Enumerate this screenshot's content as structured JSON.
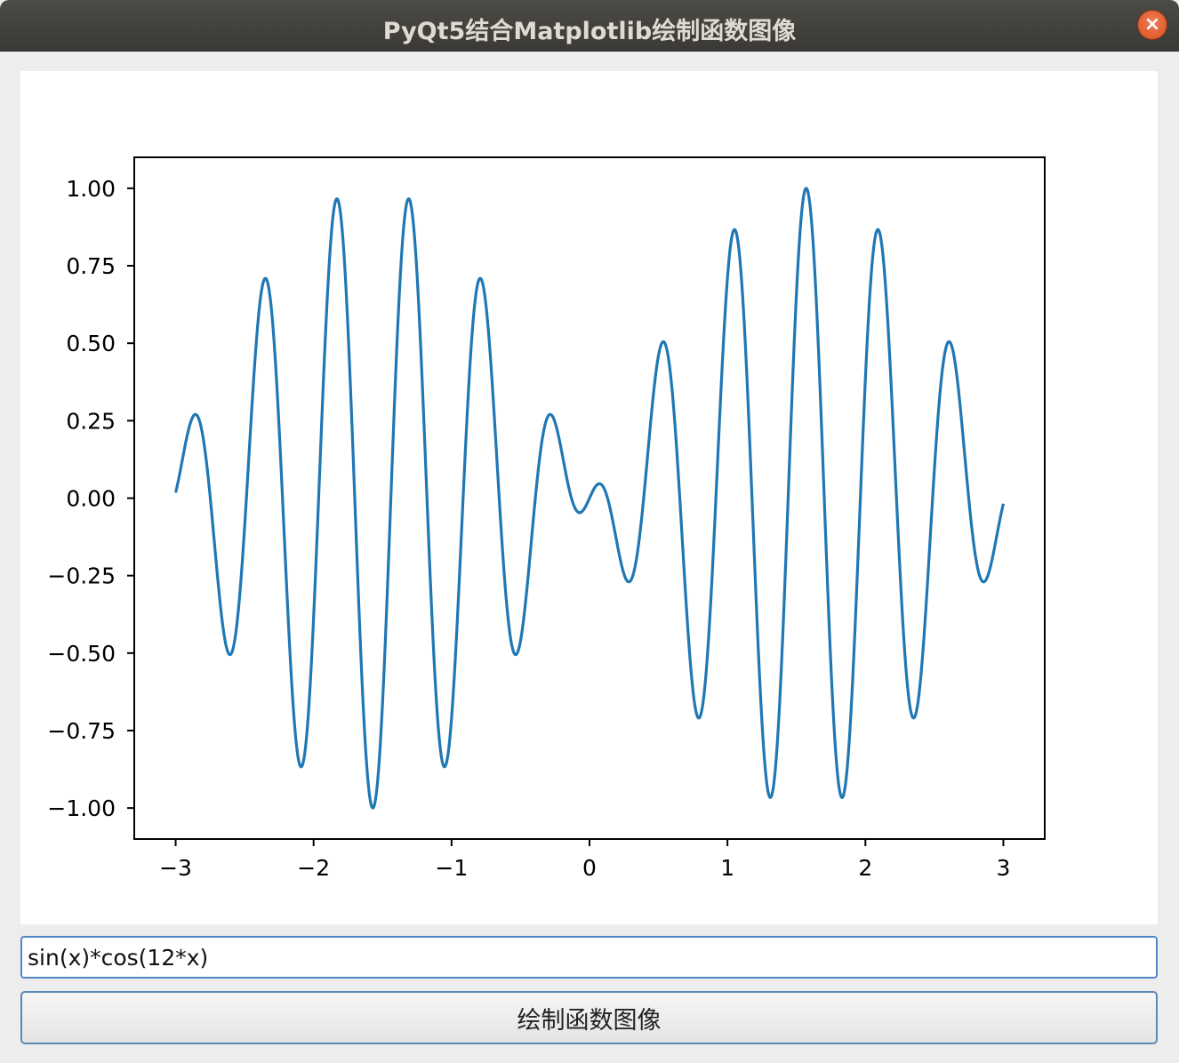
{
  "window": {
    "title": "PyQt5结合Matplotlib绘制函数图像",
    "close_symbol": "×"
  },
  "controls": {
    "function_input_value": "sin(x)*cos(12*x)",
    "plot_button_label": "绘制函数图像"
  },
  "colors": {
    "line": "#1f77b4",
    "close_button": "#e2612b"
  },
  "chart_data": {
    "type": "line",
    "expression": "sin(x)*cos(12*x)",
    "x_range": [
      -3,
      3
    ],
    "xlim": [
      -3.3,
      3.3
    ],
    "ylim": [
      -1.1,
      1.1
    ],
    "x_ticks": [
      -3,
      -2,
      -1,
      0,
      1,
      2,
      3
    ],
    "x_tick_labels": [
      "−3",
      "−2",
      "−1",
      "0",
      "1",
      "2",
      "3"
    ],
    "y_ticks": [
      -1.0,
      -0.75,
      -0.5,
      -0.25,
      0.0,
      0.25,
      0.5,
      0.75,
      1.0
    ],
    "y_tick_labels": [
      "−1.00",
      "−0.75",
      "−0.50",
      "−0.25",
      "0.00",
      "0.25",
      "0.50",
      "0.75",
      "1.00"
    ],
    "grid": false,
    "sample_points": [
      [
        -3.0,
        0.02
      ],
      [
        -2.87,
        0.27
      ],
      [
        -2.62,
        -0.5
      ],
      [
        -2.36,
        0.71
      ],
      [
        -2.1,
        -0.87
      ],
      [
        -1.84,
        0.97
      ],
      [
        -1.58,
        -1.0
      ],
      [
        -1.31,
        0.97
      ],
      [
        -1.05,
        -0.87
      ],
      [
        -0.79,
        0.71
      ],
      [
        -0.53,
        -0.5
      ],
      [
        -0.27,
        0.27
      ],
      [
        -0.08,
        -0.04
      ],
      [
        0.08,
        0.05
      ],
      [
        0.27,
        -0.27
      ],
      [
        0.53,
        0.5
      ],
      [
        0.79,
        -0.71
      ],
      [
        1.05,
        0.87
      ],
      [
        1.31,
        -0.97
      ],
      [
        1.58,
        1.0
      ],
      [
        1.84,
        -0.97
      ],
      [
        2.1,
        0.87
      ],
      [
        2.36,
        -0.71
      ],
      [
        2.62,
        0.5
      ],
      [
        2.87,
        -0.27
      ],
      [
        3.0,
        -0.02
      ]
    ]
  }
}
